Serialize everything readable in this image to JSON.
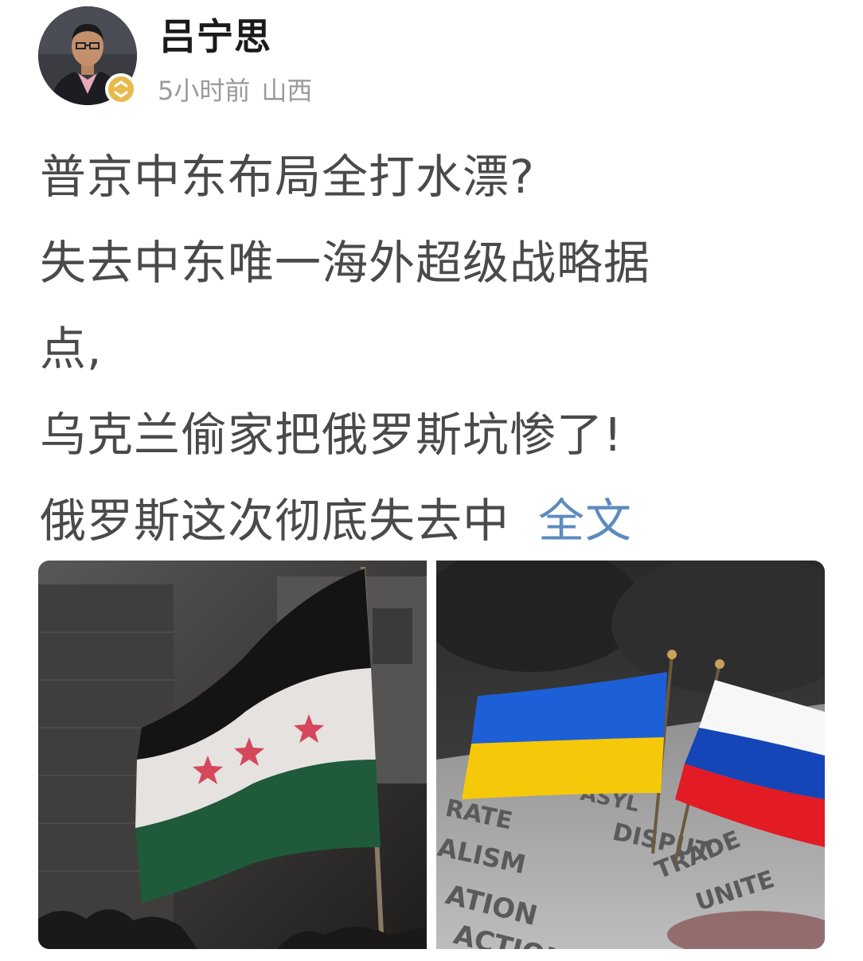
{
  "author": {
    "name": "吕宁思",
    "time": "5小时前",
    "location": "山西"
  },
  "post": {
    "lines": [
      "普京中东布局全打水漂?",
      "失去中东唯一海外超级战略据",
      "点,",
      "乌克兰偷家把俄罗斯坑惨了!",
      "俄罗斯这次彻底失去中"
    ],
    "read_more": "全文"
  },
  "images": {
    "left": {
      "icon": "syrian-opposition-flag-photo"
    },
    "right": {
      "icon": "ukraine-russia-flags-photo",
      "background_words": [
        "ASYL",
        "RATE",
        "DISPUT",
        "ALISM",
        "TRADE",
        "ATION",
        "UNITE",
        "ACTION"
      ]
    }
  },
  "colors": {
    "name": "#1a1a1a",
    "meta": "#9a9a9a",
    "body": "#4a4a4a",
    "link": "#5c8bbd",
    "badge": "#e8ba4c"
  }
}
